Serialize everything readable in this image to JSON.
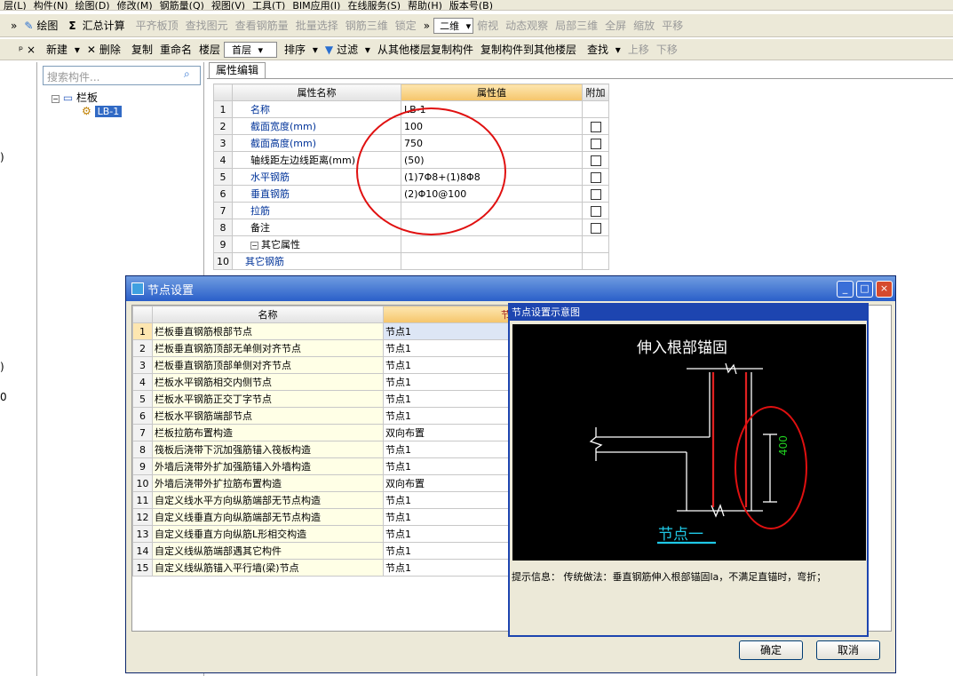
{
  "menubar": {
    "items": [
      "层(L)",
      "构件(N)",
      "绘图(D)",
      "修改(M)",
      "钢筋量(Q)",
      "视图(V)",
      "工具(T)",
      "BIM应用(I)",
      "在线服务(S)",
      "帮助(H)",
      "版本号(B)"
    ]
  },
  "toolbar1": {
    "draw": "绘图",
    "sum_icon": "Σ",
    "sum": "汇总计算",
    "align_top": "平齐板顶",
    "find_elem": "查找图元",
    "view_rebar": "查看钢筋量",
    "batch_select": "批量选择",
    "rebar_3d": "钢筋三维",
    "lock": "锁定",
    "view_mode": "二维",
    "top_view": "俯视",
    "dynamic_view": "动态观察",
    "local_3d": "局部三维",
    "fullscreen": "全屏",
    "zoom": "缩放",
    "pan": "平移"
  },
  "toolbar2": {
    "new": "新建",
    "delete": "删除",
    "copy": "复制",
    "rename": "重命名",
    "floor_label": "楼层",
    "floor_value": "首层",
    "sort": "排序",
    "filter": "过滤",
    "copy_from_floor": "从其他楼层复制构件",
    "copy_to_floor": "复制构件到其他楼层",
    "find": "查找",
    "move_up": "上移",
    "move_down": "下移"
  },
  "left_edge": {
    "chars": [
      ")",
      ")",
      "0"
    ]
  },
  "search": {
    "placeholder": "搜索构件..."
  },
  "tree": {
    "root": "栏板",
    "child": "LB-1"
  },
  "props": {
    "tab": "属性编辑",
    "headers": [
      "属性名称",
      "属性值",
      "附加"
    ],
    "rows": [
      {
        "n": "1",
        "name": "名称",
        "value": "LB-1",
        "link": true,
        "cb": false
      },
      {
        "n": "2",
        "name": "截面宽度(mm)",
        "value": "100",
        "link": true,
        "cb": true
      },
      {
        "n": "3",
        "name": "截面高度(mm)",
        "value": "750",
        "link": true,
        "cb": true
      },
      {
        "n": "4",
        "name": "轴线距左边线距离(mm)",
        "value": "(50)",
        "link": false,
        "cb": true
      },
      {
        "n": "5",
        "name": "水平钢筋",
        "value": "(1)7Φ8+(1)8Φ8",
        "link": true,
        "cb": true
      },
      {
        "n": "6",
        "name": "垂直钢筋",
        "value": "(2)Φ10@100",
        "link": true,
        "cb": true
      },
      {
        "n": "7",
        "name": "拉筋",
        "value": "",
        "link": true,
        "cb": true
      },
      {
        "n": "8",
        "name": "备注",
        "value": "",
        "link": false,
        "cb": true
      },
      {
        "n": "9",
        "name": "其它属性",
        "value": "",
        "link": false,
        "cb": false
      },
      {
        "n": "10",
        "name": "其它钢筋",
        "value": "",
        "link": true,
        "cb": false
      }
    ]
  },
  "dialog": {
    "title": "节点设置",
    "headers": [
      "名称",
      "节点"
    ],
    "rows": [
      {
        "n": "1",
        "name": "栏板垂直钢筋根部节点",
        "value": "节点1"
      },
      {
        "n": "2",
        "name": "栏板垂直钢筋顶部无单侧对齐节点",
        "value": "节点1"
      },
      {
        "n": "3",
        "name": "栏板垂直钢筋顶部单侧对齐节点",
        "value": "节点1"
      },
      {
        "n": "4",
        "name": "栏板水平钢筋相交内侧节点",
        "value": "节点1"
      },
      {
        "n": "5",
        "name": "栏板水平钢筋正交丁字节点",
        "value": "节点1"
      },
      {
        "n": "6",
        "name": "栏板水平钢筋端部节点",
        "value": "节点1"
      },
      {
        "n": "7",
        "name": "栏板拉筋布置构造",
        "value": "双向布置"
      },
      {
        "n": "8",
        "name": "筏板后浇带下沉加强筋锚入筏板构造",
        "value": "节点1"
      },
      {
        "n": "9",
        "name": "外墙后浇带外扩加强筋锚入外墙构造",
        "value": "节点1"
      },
      {
        "n": "10",
        "name": "外墙后浇带外扩拉筋布置构造",
        "value": "双向布置"
      },
      {
        "n": "11",
        "name": "自定义线水平方向纵筋端部无节点构造",
        "value": "节点1"
      },
      {
        "n": "12",
        "name": "自定义线垂直方向纵筋端部无节点构造",
        "value": "节点1"
      },
      {
        "n": "13",
        "name": "自定义线垂直方向纵筋L形相交构造",
        "value": "节点1"
      },
      {
        "n": "14",
        "name": "自定义线纵筋端部遇其它构件",
        "value": "节点1"
      },
      {
        "n": "15",
        "name": "自定义线纵筋锚入平行墙(梁)节点",
        "value": "节点1"
      }
    ],
    "diagram_title": "节点设置示意图",
    "diagram_caption": "伸入根部锚固",
    "diagram_dim": "400",
    "diagram_node": "节点一",
    "hint_label": "提示信息：",
    "hint_text": "传统做法：垂直钢筋伸入根部锚固la，不满足直锚时，弯折；",
    "ok": "确定",
    "cancel": "取消",
    "minimize": "_",
    "maximize": "□",
    "close": "×"
  },
  "colors": {
    "annotation_red": "#e01010",
    "diagram_bg": "#000000",
    "rebar_red": "#e02020",
    "dim_green": "#20d020",
    "node_cyan": "#1fc8e6",
    "header_orange": "#f5c56a"
  }
}
